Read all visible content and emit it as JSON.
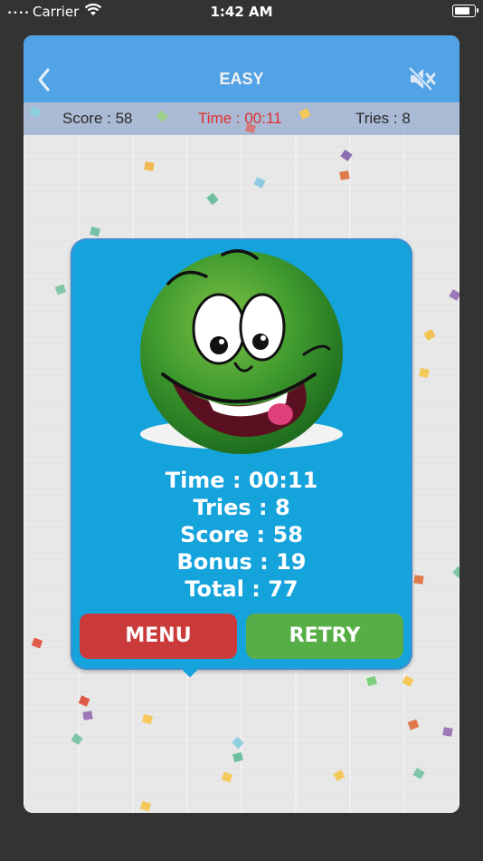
{
  "status_bar": {
    "signal": "••••",
    "carrier": "Carrier",
    "time": "1:42 AM",
    "wifi_icon": "wifi-icon",
    "battery_icon": "battery-icon",
    "battery_level": 0.9
  },
  "navbar": {
    "title": "EASY",
    "back_icon": "chevron-left-icon",
    "sound_icon": "speaker-muted-icon"
  },
  "scorebar": {
    "score": "Score : 58",
    "time": "Time : 00:11",
    "tries": "Tries : 8"
  },
  "result_dialog": {
    "stats": {
      "time": "Time : 00:11",
      "tries": "Tries : 8",
      "score": "Score : 58",
      "bonus": "Bonus : 19",
      "total": "Total : 77"
    },
    "menu_label": "MENU",
    "retry_label": "RETRY"
  },
  "colors": {
    "navbar": "#52a3e6",
    "dialog": "#15a3dc",
    "menu_button": "#cb3a3a",
    "retry_button": "#58ae46",
    "timer_text": "#e03131"
  }
}
